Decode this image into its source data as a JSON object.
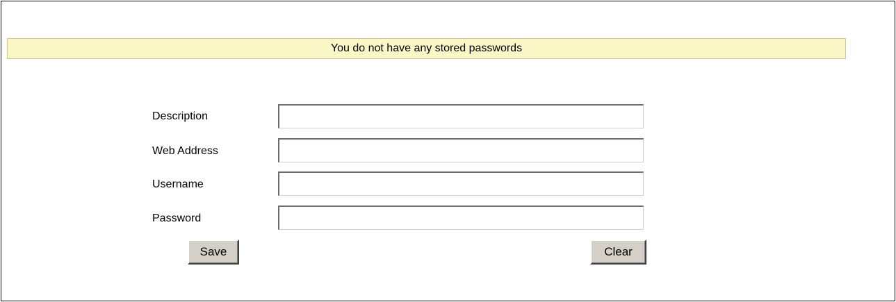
{
  "notice": {
    "message": "You do not have any stored passwords"
  },
  "form": {
    "description": {
      "label": "Description",
      "value": "",
      "placeholder": ""
    },
    "web_address": {
      "label": "Web Address",
      "value": "",
      "placeholder": ""
    },
    "username": {
      "label": "Username",
      "value": "",
      "placeholder": ""
    },
    "password": {
      "label": "Password",
      "value": "",
      "placeholder": ""
    }
  },
  "actions": {
    "save_label": "Save",
    "clear_label": "Clear"
  },
  "colors": {
    "notice_background": "#fbf8c8",
    "notice_border": "#d7c58e",
    "button_face": "#d4d0c8"
  }
}
